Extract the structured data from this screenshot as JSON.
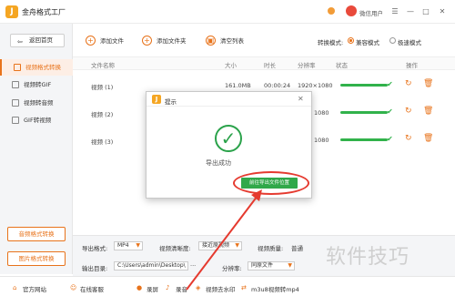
{
  "app": {
    "title": "金舟格式工厂",
    "user_label": "微信用户"
  },
  "window_controls": [
    "☰",
    "—",
    "□",
    "✕"
  ],
  "sidebar": {
    "back_label": "返回首页",
    "items": [
      {
        "label": "视频格式转换",
        "active": true
      },
      {
        "label": "视频转GIF",
        "active": false
      },
      {
        "label": "视频转音频",
        "active": false
      },
      {
        "label": "GIF转视频",
        "active": false
      }
    ],
    "bottom_buttons": [
      "音频格式转换",
      "图片格式转换"
    ]
  },
  "toolbar": {
    "add_file": "添加文件",
    "add_folder": "添加文件夹",
    "clear_list": "清空列表",
    "convert_mode_label": "转换模式:",
    "mode_compat": "兼容模式",
    "mode_fast": "极速模式"
  },
  "table": {
    "headers": {
      "name": "文件名称",
      "size": "大小",
      "duration": "时长",
      "resolution": "分辨率",
      "status": "状态",
      "action": "操作"
    },
    "rows": [
      {
        "name": "视频 (1)",
        "size": "161.0MB",
        "duration": "00:00:24",
        "resolution": "1920×1080"
      },
      {
        "name": "视频 (2)",
        "size": "",
        "duration": "",
        "resolution": "1080"
      },
      {
        "name": "视频 (3)",
        "size": "",
        "duration": "",
        "resolution": "1080"
      }
    ]
  },
  "dialog": {
    "title": "提示",
    "message": "导出成功",
    "button": "前往导出文件位置"
  },
  "settings": {
    "format_label": "导出格式:",
    "format_value": "MP4",
    "clarity_label": "视频清晰度:",
    "clarity_value": "接近原视频",
    "quality_label": "视频质量:",
    "quality_value": "普通",
    "dir_label": "输出目录:",
    "dir_value": "C:\\Users\\admin\\Desktop\\",
    "dir_more": "···",
    "res_label": "分辨率:",
    "res_value": "同原文件"
  },
  "footer": [
    {
      "label": "官方网站",
      "icon": "home-icon"
    },
    {
      "label": "在线客服",
      "icon": "chat-icon"
    },
    {
      "label": "录屏",
      "icon": "record-icon"
    },
    {
      "label": "录音",
      "icon": "mic-icon"
    },
    {
      "label": "视频去水印",
      "icon": "watermark-icon"
    },
    {
      "label": "m3u8视频转mp4",
      "icon": "convert-icon"
    }
  ],
  "watermark": "软件技巧",
  "colors": {
    "accent": "#e8731b",
    "success": "#31a84a",
    "annotation": "#e53a2f"
  }
}
